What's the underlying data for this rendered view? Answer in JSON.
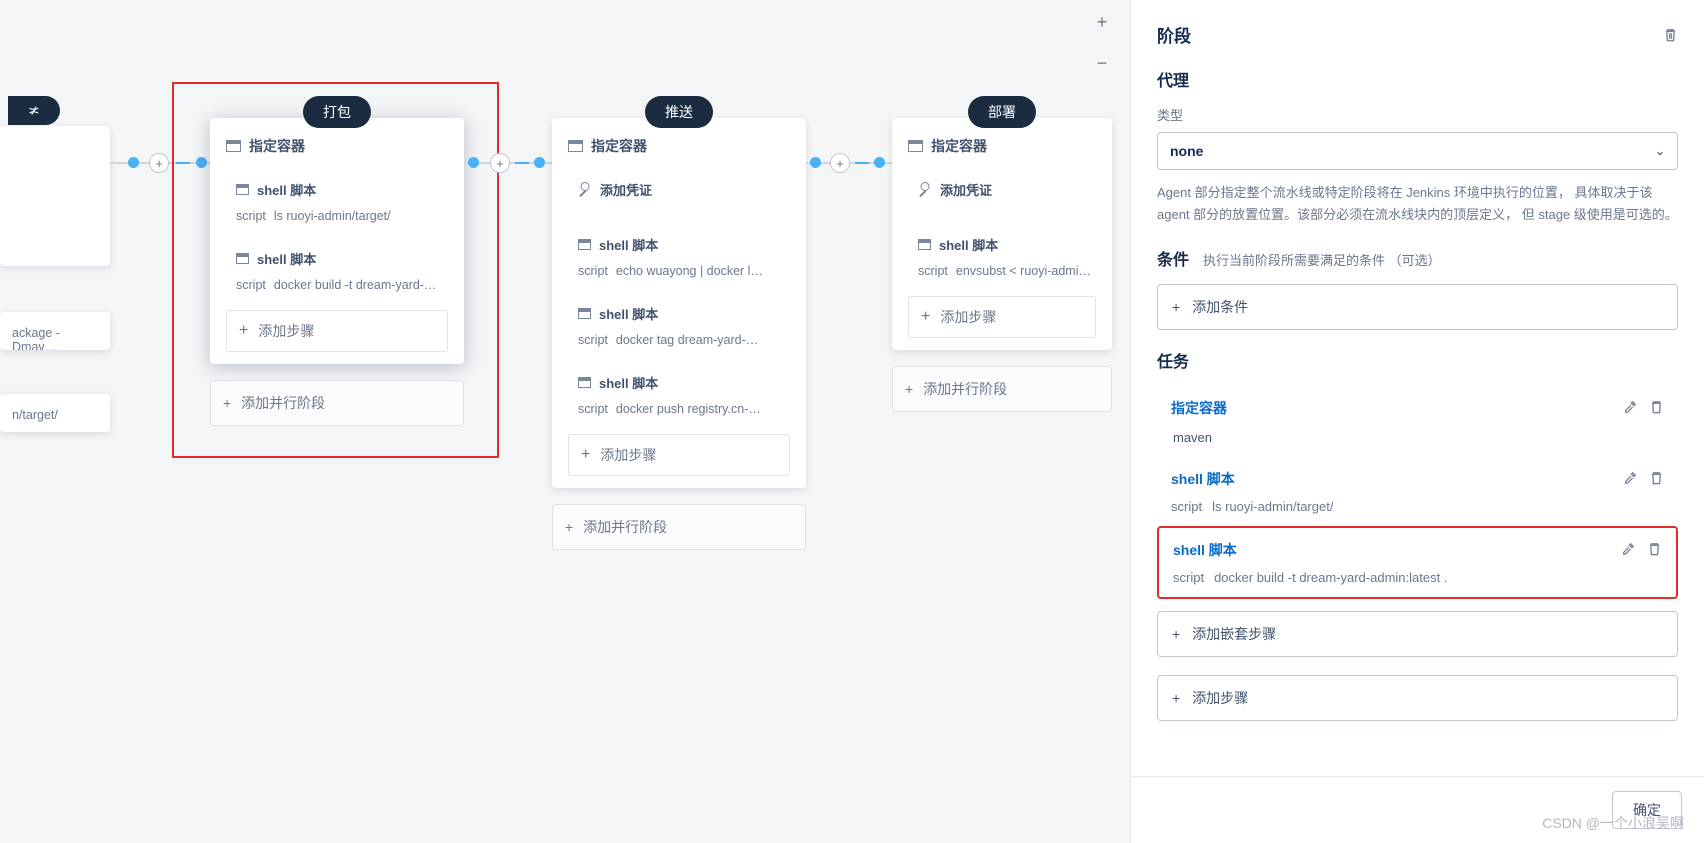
{
  "zoom": {
    "plus": "+",
    "minus": "−"
  },
  "watermark": "CSDN @一个小浪吴啊",
  "labels": {
    "add_step": "添加步骤",
    "add_parallel": "添加并行阶段",
    "script_label": "script",
    "plus": "+"
  },
  "stage_left": {
    "pill": "≭",
    "frag1": "ackage -Dmav…",
    "frag2": "n/target/"
  },
  "stages": [
    {
      "name": "打包",
      "container_label": "指定容器",
      "steps": [
        {
          "title": "shell 脚本",
          "script": "ls ruoyi-admin/target/"
        },
        {
          "title": "shell 脚本",
          "script": "docker build -t dream-yard-…"
        }
      ]
    },
    {
      "name": "推送",
      "container_label": "指定容器",
      "steps": [
        {
          "title": "添加凭证",
          "icon": "key"
        },
        {
          "title": "shell 脚本",
          "script": "echo wuayong | docker l…"
        },
        {
          "title": "shell 脚本",
          "script": "docker tag dream-yard-…"
        },
        {
          "title": "shell 脚本",
          "script": "docker push registry.cn-…"
        }
      ]
    },
    {
      "name": "部署",
      "container_label": "指定容器",
      "steps": [
        {
          "title": "添加凭证",
          "icon": "key"
        },
        {
          "title": "shell 脚本",
          "script": "envsubst < ruoyi-admin/…"
        }
      ]
    }
  ],
  "panel": {
    "title": "阶段",
    "agent_heading": "代理",
    "type_label": "类型",
    "type_value": "none",
    "agent_help": "Agent 部分指定整个流水线或特定阶段将在 Jenkins 环境中执行的位置， 具体取决于该 agent 部分的放置位置。该部分必须在流水线块内的顶层定义， 但 stage 级使用是可选的。",
    "cond_heading": "条件",
    "cond_desc": "执行当前阶段所需要满足的条件 （可选）",
    "add_condition": "添加条件",
    "tasks_heading": "任务",
    "tasks": [
      {
        "title": "指定容器",
        "sub": "maven"
      },
      {
        "title": "shell 脚本",
        "script": "ls ruoyi-admin/target/"
      },
      {
        "title": "shell 脚本",
        "script": "docker build -t dream-yard-admin:latest .",
        "highlighted": true
      }
    ],
    "add_nested": "添加嵌套步骤",
    "add_step": "添加步骤",
    "ok": "确定"
  }
}
